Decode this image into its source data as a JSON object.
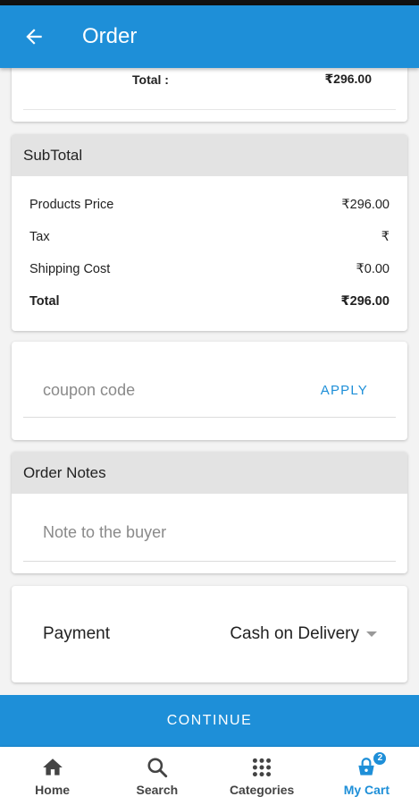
{
  "appbar": {
    "title": "Order"
  },
  "product_card": {
    "total_label": "Total :",
    "total_value": "₹296.00"
  },
  "subtotal": {
    "header": "SubTotal",
    "rows": [
      {
        "label": "Products Price",
        "value": "₹296.00"
      },
      {
        "label": "Tax",
        "value": "₹"
      },
      {
        "label": "Shipping Cost",
        "value": "₹0.00"
      },
      {
        "label": "Total",
        "value": "₹296.00"
      }
    ]
  },
  "coupon": {
    "placeholder": "coupon code",
    "apply_label": "APPLY"
  },
  "notes": {
    "header": "Order Notes",
    "placeholder": "Note to the buyer"
  },
  "payment": {
    "label": "Payment",
    "selected": "Cash on Delivery"
  },
  "continue_label": "CONTINUE",
  "bottom_nav": {
    "items": [
      {
        "label": "Home",
        "icon": "home-icon"
      },
      {
        "label": "Search",
        "icon": "search-icon"
      },
      {
        "label": "Categories",
        "icon": "grid-icon"
      },
      {
        "label": "My Cart",
        "icon": "cart-icon",
        "badge": "2"
      }
    ]
  },
  "colors": {
    "primary": "#1e8fd8",
    "header_bg": "#e3e3e3"
  }
}
